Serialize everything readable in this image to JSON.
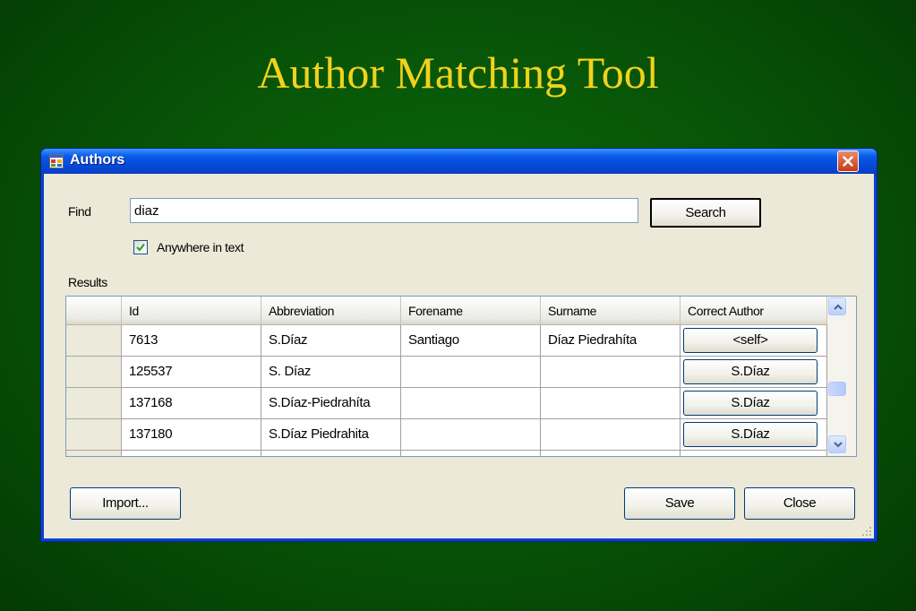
{
  "slide": {
    "title": "Author Matching Tool"
  },
  "window": {
    "title": "Authors"
  },
  "find": {
    "label": "Find",
    "value": "diaz",
    "search_label": "Search"
  },
  "option": {
    "anywhere_label": "Anywhere in text",
    "anywhere_checked": true
  },
  "results": {
    "label": "Results",
    "columns": [
      "Id",
      "Abbreviation",
      "Forename",
      "Surname",
      "Correct Author"
    ],
    "rows": [
      {
        "id": "7613",
        "abbreviation": "S.Díaz",
        "forename": "Santiago",
        "surname": "Díaz Piedrahíta",
        "correct_author": "<self>"
      },
      {
        "id": "125537",
        "abbreviation": "S. Díaz",
        "forename": "",
        "surname": "",
        "correct_author": "S.Díaz"
      },
      {
        "id": "137168",
        "abbreviation": "S.Díaz-Piedrahíta",
        "forename": "",
        "surname": "",
        "correct_author": "S.Díaz"
      },
      {
        "id": "137180",
        "abbreviation": "S.Díaz Piedrahita",
        "forename": "",
        "surname": "",
        "correct_author": "S.Díaz"
      }
    ]
  },
  "footer": {
    "import_label": "Import...",
    "save_label": "Save",
    "close_label": "Close"
  },
  "colors": {
    "slide_title": "#f2d21a",
    "titlebar": "#0548d6",
    "dialog_bg": "#ece9d8"
  },
  "icons": {
    "app": "window-app-icon",
    "close": "close-x-icon",
    "check": "checkmark-icon"
  }
}
